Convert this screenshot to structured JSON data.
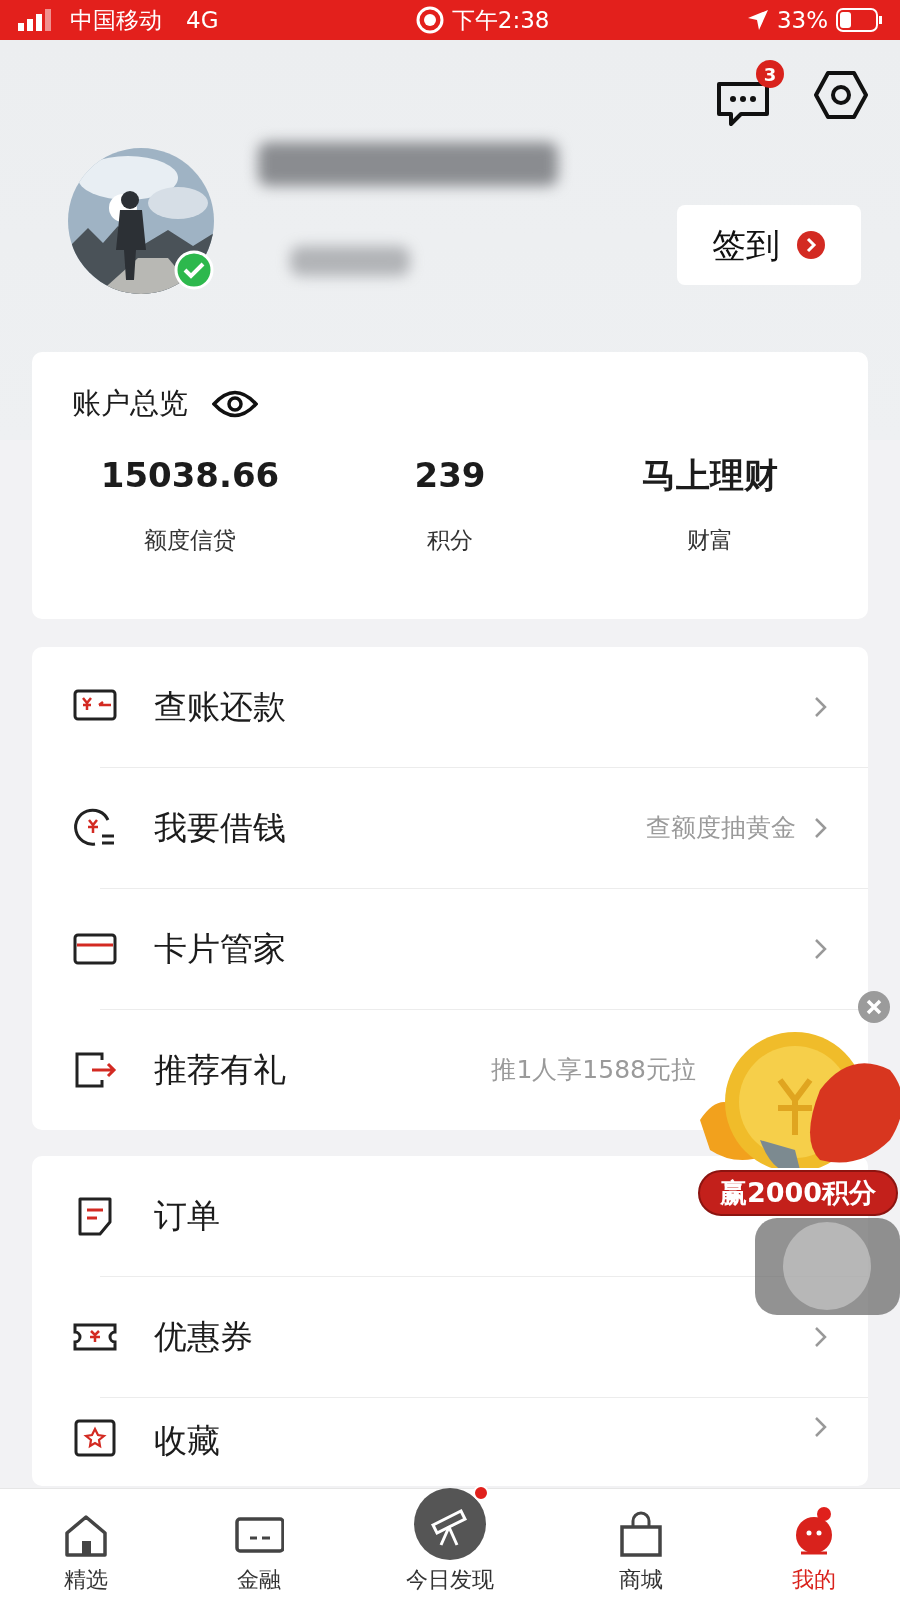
{
  "status_bar": {
    "carrier": "中国移动",
    "network": "4G",
    "time": "下午2:38",
    "battery": "33%"
  },
  "header": {
    "message_count": "3",
    "verified": true,
    "checkin_label": "签到"
  },
  "account_overview": {
    "title": "账户总览",
    "stats": [
      {
        "value": "15038.66",
        "label": "额度信贷"
      },
      {
        "value": "239",
        "label": "积分"
      },
      {
        "value": "马上理财",
        "label": "财富"
      }
    ]
  },
  "menu_groups": [
    [
      {
        "label": "查账还款",
        "arrow": true
      },
      {
        "label": "我要借钱",
        "hint": "查额度抽黄金",
        "arrow": true
      },
      {
        "label": "卡片管家",
        "arrow": true
      },
      {
        "label": "推荐有礼",
        "hint": "推1人享1588元拉",
        "arrow": false
      }
    ],
    [
      {
        "label": "订单",
        "arrow": false
      },
      {
        "label": "优惠券",
        "arrow": true
      },
      {
        "label": "收藏",
        "arrow": true
      }
    ]
  ],
  "promo": {
    "badge": "赢2000积分"
  },
  "tab_bar": [
    {
      "label": "精选",
      "selected": false,
      "kind": "normal"
    },
    {
      "label": "金融",
      "selected": false,
      "kind": "normal"
    },
    {
      "label": "今日发现",
      "selected": false,
      "kind": "center",
      "dot": true
    },
    {
      "label": "商城",
      "selected": false,
      "kind": "normal"
    },
    {
      "label": "我的",
      "selected": true,
      "kind": "normal",
      "dot": true
    }
  ]
}
